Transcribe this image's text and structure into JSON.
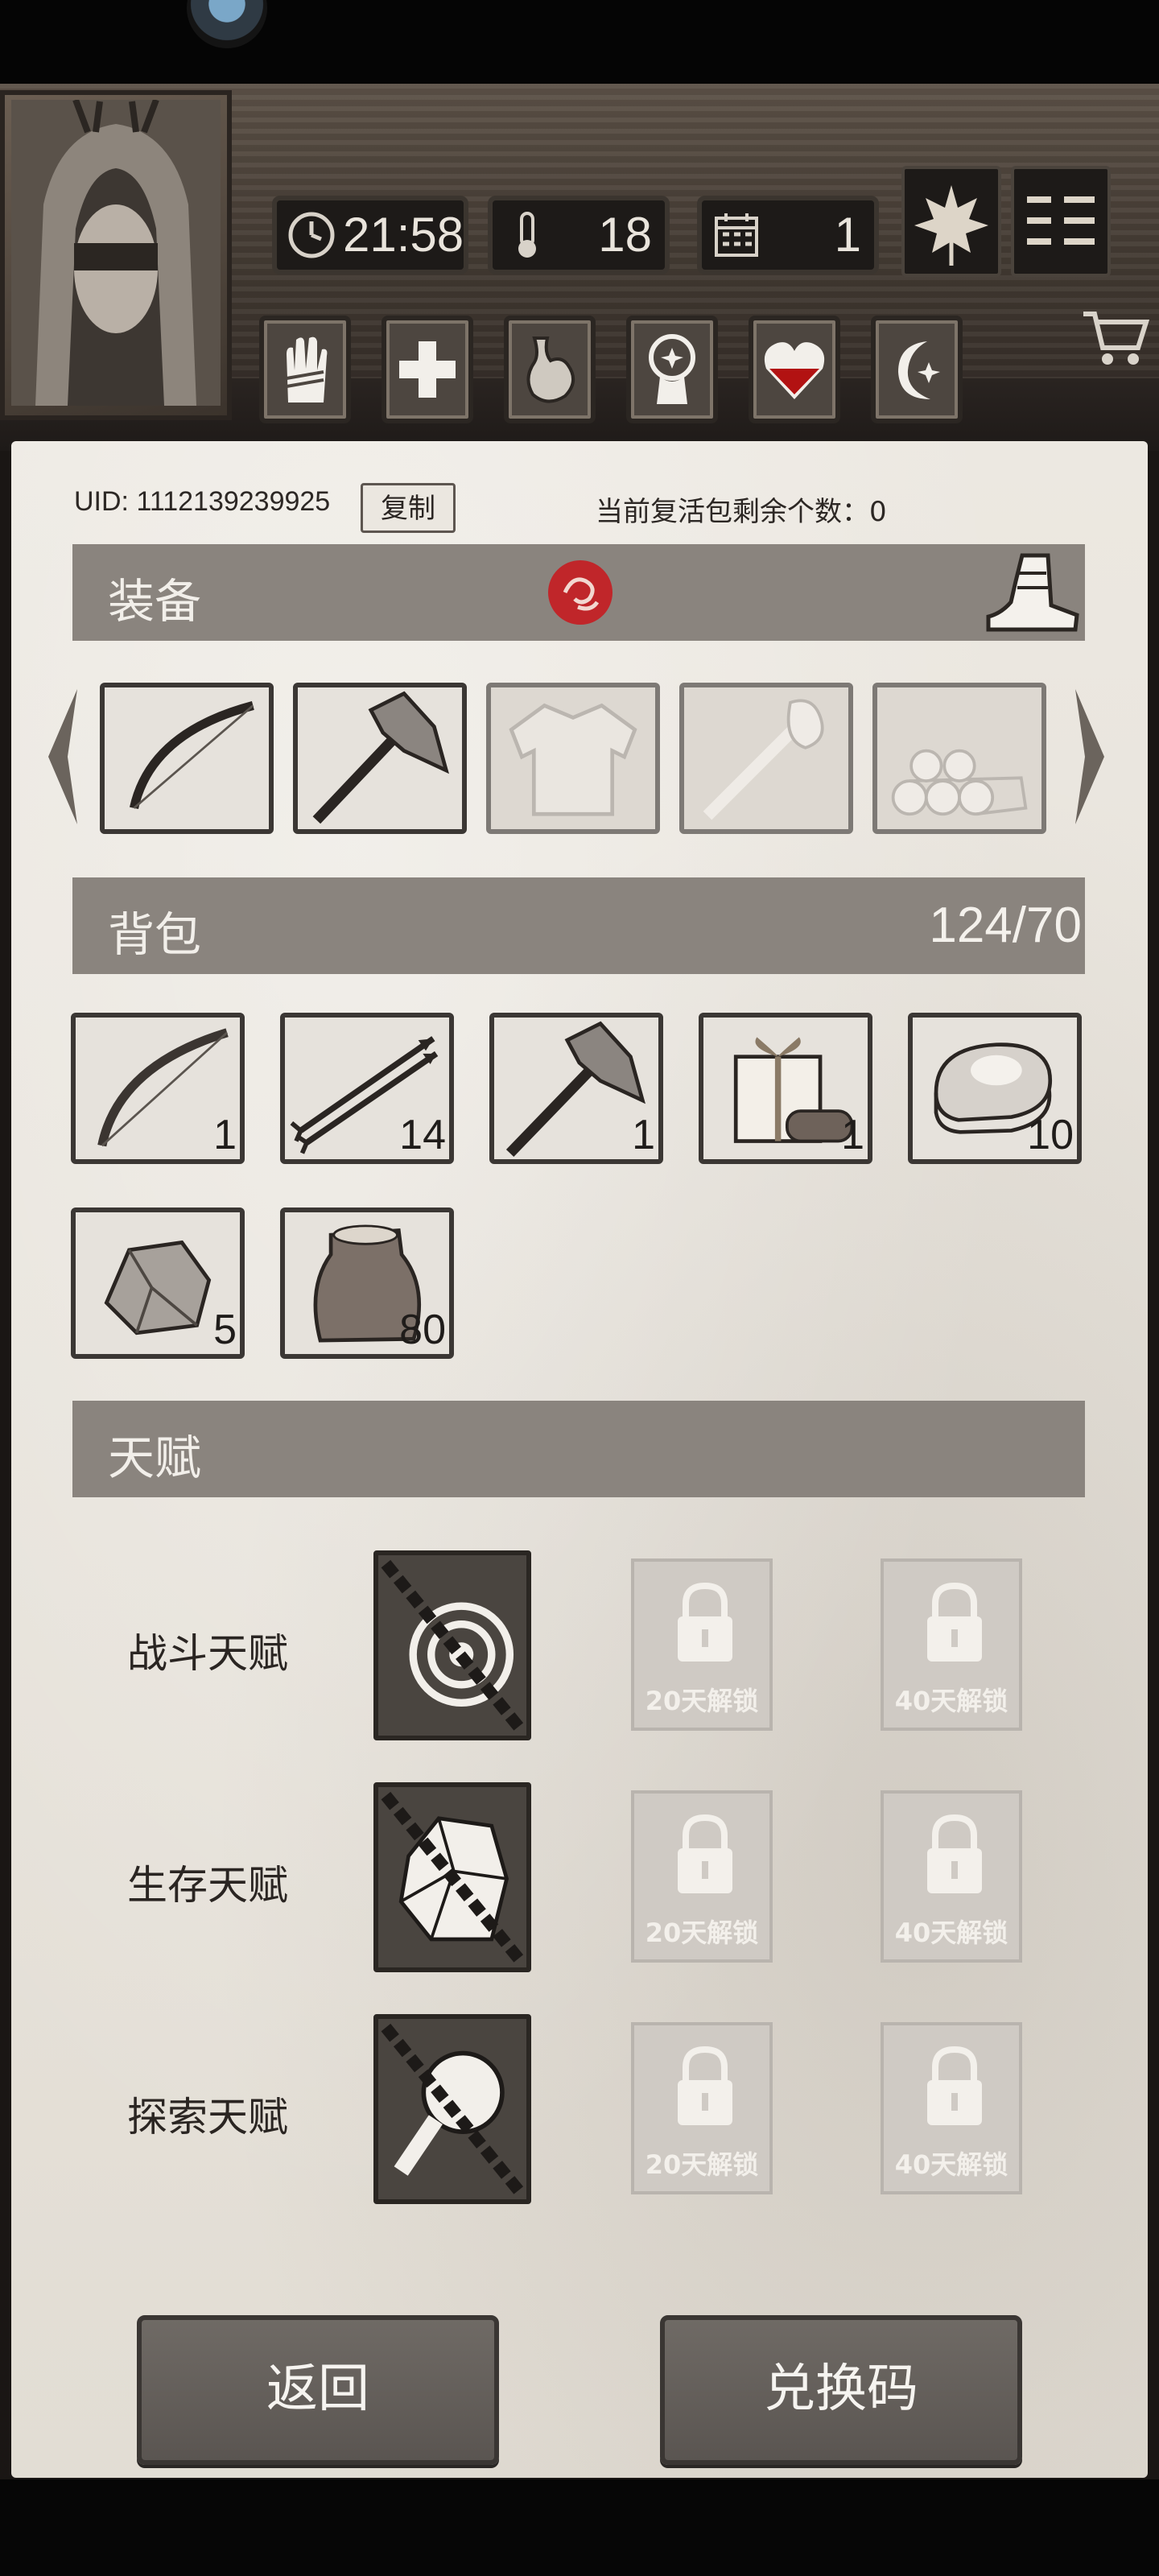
{
  "header": {
    "time": "21:58",
    "temperature": "18",
    "day": "1",
    "icons": {
      "time": "clock-icon",
      "temperature": "thermometer-icon",
      "day": "calendar-icon",
      "leaf": "maple-leaf-icon",
      "menu": "menu-icon",
      "cart": "cart-icon"
    },
    "status_icons": [
      "hand-bandage-icon",
      "health-cross-icon",
      "stomach-icon",
      "sanity-head-icon",
      "heart-icon",
      "moon-star-icon"
    ]
  },
  "account": {
    "uid_label": "UID: 1112139239925",
    "copy_label": "复制",
    "revive_text": "当前复活包剩余个数：0"
  },
  "equipment": {
    "title": "装备",
    "slots": [
      {
        "item": "bow",
        "equipped": true
      },
      {
        "item": "axe",
        "equipped": true
      },
      {
        "item": "clothes",
        "equipped": false
      },
      {
        "item": "torch",
        "equipped": false
      },
      {
        "item": "logs",
        "equipped": false
      }
    ]
  },
  "backpack": {
    "title": "背包",
    "count": "124/70",
    "items": [
      {
        "item": "bow",
        "qty": "1"
      },
      {
        "item": "arrows",
        "qty": "14"
      },
      {
        "item": "axe",
        "qty": "1"
      },
      {
        "item": "gift-box",
        "qty": "1"
      },
      {
        "item": "meat",
        "qty": "10"
      },
      {
        "item": "stone",
        "qty": "5"
      },
      {
        "item": "seed-sack",
        "qty": "80"
      }
    ]
  },
  "talents": {
    "title": "天赋",
    "rows": [
      {
        "label": "战斗天赋",
        "lock20": "20天解锁",
        "lock40": "40天解锁"
      },
      {
        "label": "生存天赋",
        "lock20": "20天解锁",
        "lock40": "40天解锁"
      },
      {
        "label": "探索天赋",
        "lock20": "20天解锁",
        "lock40": "40天解锁"
      }
    ]
  },
  "footer": {
    "back_label": "返回",
    "code_label": "兑换码"
  },
  "colors": {
    "section_bar": "#8a847e",
    "panel": "#e6e2db",
    "heart_red": "#b21212",
    "seal_red": "#c0262a"
  }
}
